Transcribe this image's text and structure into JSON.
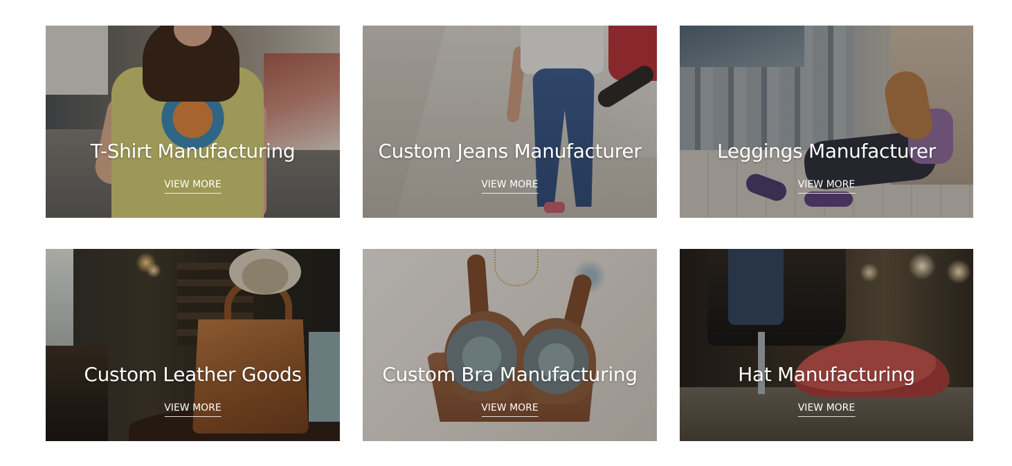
{
  "cards": [
    {
      "title": "T-Shirt Manufacturing",
      "link": "VIEW MORE",
      "image": "woman-in-yellow-t-shirt-photo"
    },
    {
      "title": "Custom Jeans Manufacturer",
      "link": "VIEW MORE",
      "image": "person-in-jeans-with-skateboard-photo"
    },
    {
      "title": "Leggings Manufacturer",
      "link": "VIEW MORE",
      "image": "woman-in-leggings-tying-shoe-photo"
    },
    {
      "title": "Custom Leather Goods",
      "link": "VIEW MORE",
      "image": "leather-tote-bag-photo"
    },
    {
      "title": "Custom Bra Manufacturing",
      "link": "VIEW MORE",
      "image": "lace-bra-photo"
    },
    {
      "title": "Hat Manufacturing",
      "link": "VIEW MORE",
      "image": "cap-under-sewing-machine-photo"
    }
  ]
}
